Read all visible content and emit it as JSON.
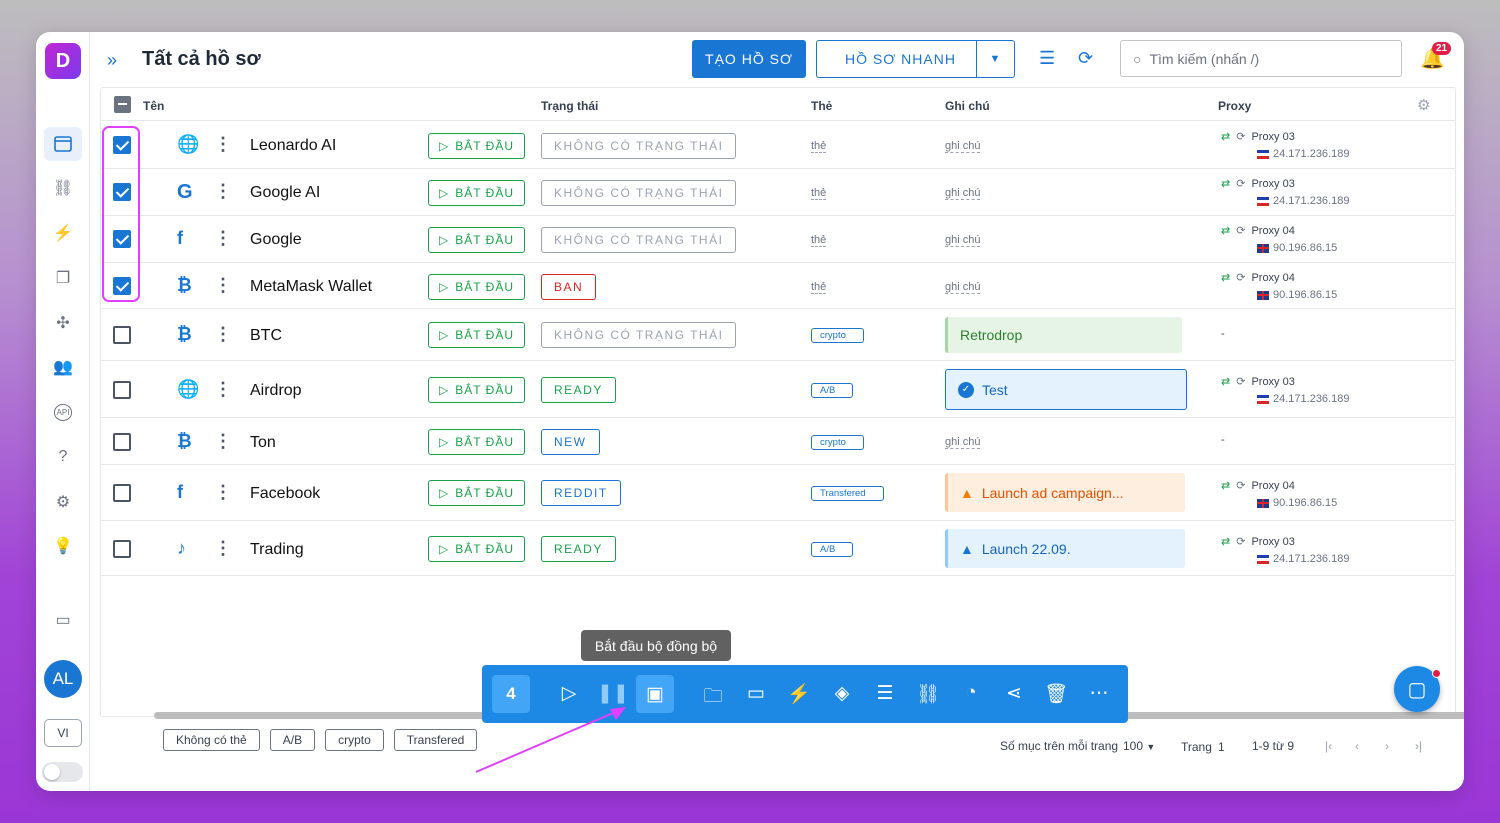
{
  "header": {
    "title": "Tất cả hồ sơ",
    "create_label": "TẠO HỒ SƠ",
    "quick_label": "HỒ SƠ NHANH",
    "search_placeholder": "Tìm kiếm (nhấn /)",
    "notif_count": "21"
  },
  "sidebar": {
    "logo": "D",
    "avatar": "AL",
    "lang": "VI"
  },
  "table": {
    "headers": {
      "name": "Tên",
      "status": "Trạng thái",
      "tag": "Thẻ",
      "note": "Ghi chú",
      "proxy": "Proxy"
    },
    "start_label": "BẮT ĐẦU",
    "tag_placeholder": "thẻ",
    "note_placeholder": "ghi chú",
    "rows": [
      {
        "name": "Leonardo AI",
        "status": "KHÔNG CÓ TRẠNG THÁI",
        "proxy_name": "Proxy 03",
        "proxy_ip": "24.171.236.189"
      },
      {
        "name": "Google AI",
        "status": "KHÔNG CÓ TRẠNG THÁI",
        "proxy_name": "Proxy 03",
        "proxy_ip": "24.171.236.189"
      },
      {
        "name": "Google",
        "status": "KHÔNG CÓ TRẠNG THÁI",
        "proxy_name": "Proxy 04",
        "proxy_ip": "90.196.86.15"
      },
      {
        "name": "MetaMask Wallet",
        "status": "BAN",
        "proxy_name": "Proxy 04",
        "proxy_ip": "90.196.86.15"
      },
      {
        "name": "BTC",
        "status": "KHÔNG CÓ TRẠNG THÁI",
        "tag": "crypto",
        "note": "Retrodrop",
        "proxy_empty": "-"
      },
      {
        "name": "Airdrop",
        "status": "READY",
        "tag": "A/B",
        "note": "Test",
        "proxy_name": "Proxy 03",
        "proxy_ip": "24.171.236.189"
      },
      {
        "name": "Ton",
        "status": "NEW",
        "tag": "crypto",
        "proxy_empty": "-"
      },
      {
        "name": "Facebook",
        "status": "REDDIT",
        "tag": "Transfered",
        "note": "Launch ad campaign...",
        "proxy_name": "Proxy 04",
        "proxy_ip": "90.196.86.15"
      },
      {
        "name": "Trading",
        "status": "READY",
        "tag": "A/B",
        "note": "Launch 22.09.",
        "proxy_name": "Proxy 03",
        "proxy_ip": "24.171.236.189"
      }
    ]
  },
  "footer": {
    "chips": [
      "Không có thẻ",
      "A/B",
      "crypto",
      "Transfered"
    ],
    "rows_per_page_label": "Số mục trên mỗi trang",
    "rows_per_page": "100",
    "page_label": "Trang",
    "page": "1",
    "range": "1-9 từ 9"
  },
  "action_bar": {
    "selected_count": "4",
    "tooltip": "Bắt đầu bộ đồng bộ"
  },
  "colors": {
    "accent": "#1976d2",
    "highlight": "#e040fb",
    "start": "#16a34a",
    "ban": "#dc2626"
  }
}
